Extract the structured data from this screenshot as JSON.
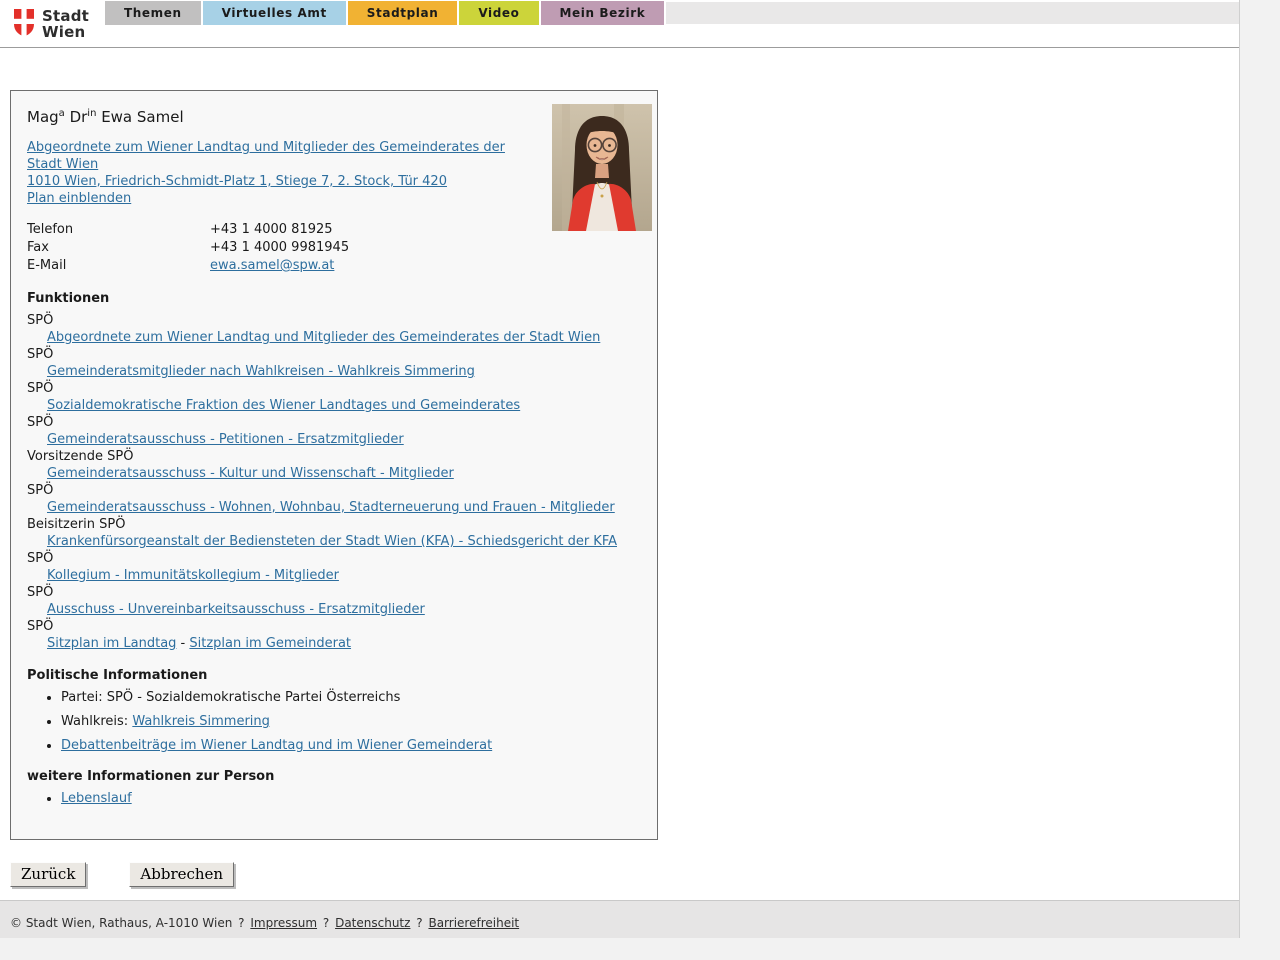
{
  "header": {
    "logo": {
      "line1": "Stadt",
      "line2": "Wien",
      "shield_color": "#e3302a"
    },
    "tabs": [
      {
        "label": "Themen",
        "color": "#c1c0c0"
      },
      {
        "label": "Virtuelles Amt",
        "color": "#a7d1e6"
      },
      {
        "label": "Stadtplan",
        "color": "#f1b233"
      },
      {
        "label": "Video",
        "color": "#ccd43a"
      },
      {
        "label": "Mein Bezirk",
        "color": "#bf9cb3"
      }
    ]
  },
  "profile": {
    "name": {
      "p1": "Mag",
      "s1": "a",
      "p2": " Dr",
      "s2": "in",
      "p3": " Ewa Samel"
    },
    "title_link": "Abgeordnete zum Wiener Landtag und Mitglieder des Gemeinderates der Stadt Wien ",
    "address_link": "1010 Wien, Friedrich-Schmidt-Platz 1, Stiege 7, 2. Stock, Tür 420",
    "plan_link": "Plan einblenden",
    "contact": [
      {
        "label": "Telefon",
        "value": "+43 1 4000 81925"
      },
      {
        "label": "Fax",
        "value": "+43 1 4000 9981945"
      },
      {
        "label": "E-Mail",
        "value": "ewa.samel@spw.at"
      }
    ]
  },
  "funktionen": {
    "heading": "Funktionen",
    "entries": [
      {
        "role": "SPÖ",
        "link": "Abgeordnete zum Wiener Landtag und Mitglieder des Gemeinderates der Stadt Wien"
      },
      {
        "role": "SPÖ",
        "link": "Gemeinderatsmitglieder nach Wahlkreisen - Wahlkreis Simmering"
      },
      {
        "role": "SPÖ",
        "link": "Sozialdemokratische Fraktion des Wiener Landtages und Gemeinderates"
      },
      {
        "role": "SPÖ",
        "link": "Gemeinderatsausschuss - Petitionen - Ersatzmitglieder"
      },
      {
        "role": "Vorsitzende SPÖ",
        "link": "Gemeinderatsausschuss - Kultur und Wissenschaft - Mitglieder"
      },
      {
        "role": "SPÖ",
        "link": "Gemeinderatsausschuss - Wohnen, Wohnbau, Stadterneuerung und Frauen - Mitglieder"
      },
      {
        "role": "Beisitzerin SPÖ",
        "link": "Krankenfürsorgeanstalt der Bediensteten der Stadt Wien (KFA) - Schiedsgericht der KFA"
      },
      {
        "role": "SPÖ",
        "link": "Kollegium - Immunitätskollegium - Mitglieder"
      },
      {
        "role": "SPÖ",
        "link": "Ausschuss - Unvereinbarkeitsausschuss - Ersatzmitglieder"
      }
    ],
    "seat_entry": {
      "role": "SPÖ",
      "link1": "Sitzplan im Landtag",
      "separator": " - ",
      "link2": "Sitzplan im Gemeinderat"
    }
  },
  "politik": {
    "heading": "Politische Informationen",
    "partei_text": "Partei: SPÖ - Sozialdemokratische Partei Österreichs",
    "wahlkreis_label": "Wahlkreis: ",
    "wahlkreis_link": "Wahlkreis Simmering",
    "debatten_link": "Debattenbeiträge im Wiener Landtag und im Wiener Gemeinderat"
  },
  "weitere": {
    "heading": "weitere Informationen zur Person",
    "lebenslauf_link": "Lebenslauf"
  },
  "buttons": {
    "back": "Zurück",
    "cancel": "Abbrechen"
  },
  "footer": {
    "copyright": "© Stadt Wien, Rathaus, A-1010 Wien",
    "separator": "?",
    "links": [
      "Impressum",
      "Datenschutz",
      "Barrierefreiheit"
    ]
  }
}
